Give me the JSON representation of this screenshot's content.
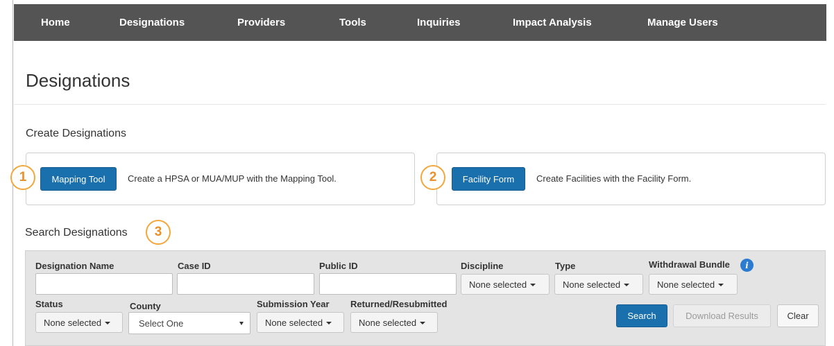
{
  "nav": {
    "items": [
      "Home",
      "Designations",
      "Providers",
      "Tools",
      "Inquiries",
      "Impact Analysis",
      "Manage Users"
    ]
  },
  "page_title": "Designations",
  "create": {
    "title": "Create Designations",
    "mapping": {
      "button": "Mapping Tool",
      "text": "Create a HPSA or MUA/MUP with the Mapping Tool."
    },
    "facility": {
      "button": "Facility Form",
      "text": "Create Facilities with the Facility Form."
    }
  },
  "callouts": [
    "1",
    "2",
    "3"
  ],
  "search": {
    "title": "Search Designations",
    "labels": {
      "designation_name": "Designation Name",
      "case_id": "Case ID",
      "public_id": "Public ID",
      "discipline": "Discipline",
      "type": "Type",
      "withdrawal_bundle": "Withdrawal Bundle",
      "status": "Status",
      "county": "County",
      "submission_year": "Submission Year",
      "returned_resubmitted": "Returned/Resubmitted"
    },
    "values": {
      "designation_name": "",
      "case_id": "",
      "public_id": "",
      "discipline": "None selected",
      "type": "None selected",
      "withdrawal_bundle": "None selected",
      "status": "None selected",
      "county": "Select One",
      "submission_year": "None selected",
      "returned_resubmitted": "None selected"
    },
    "buttons": {
      "search": "Search",
      "download": "Download Results",
      "clear": "Clear"
    }
  },
  "colors": {
    "nav_bg": "#545454",
    "primary": "#1a6fad",
    "callout": "#f3a73b",
    "info": "#2b7bd0"
  },
  "icons": {
    "info": "info-icon",
    "caret": "caret-down-icon"
  }
}
